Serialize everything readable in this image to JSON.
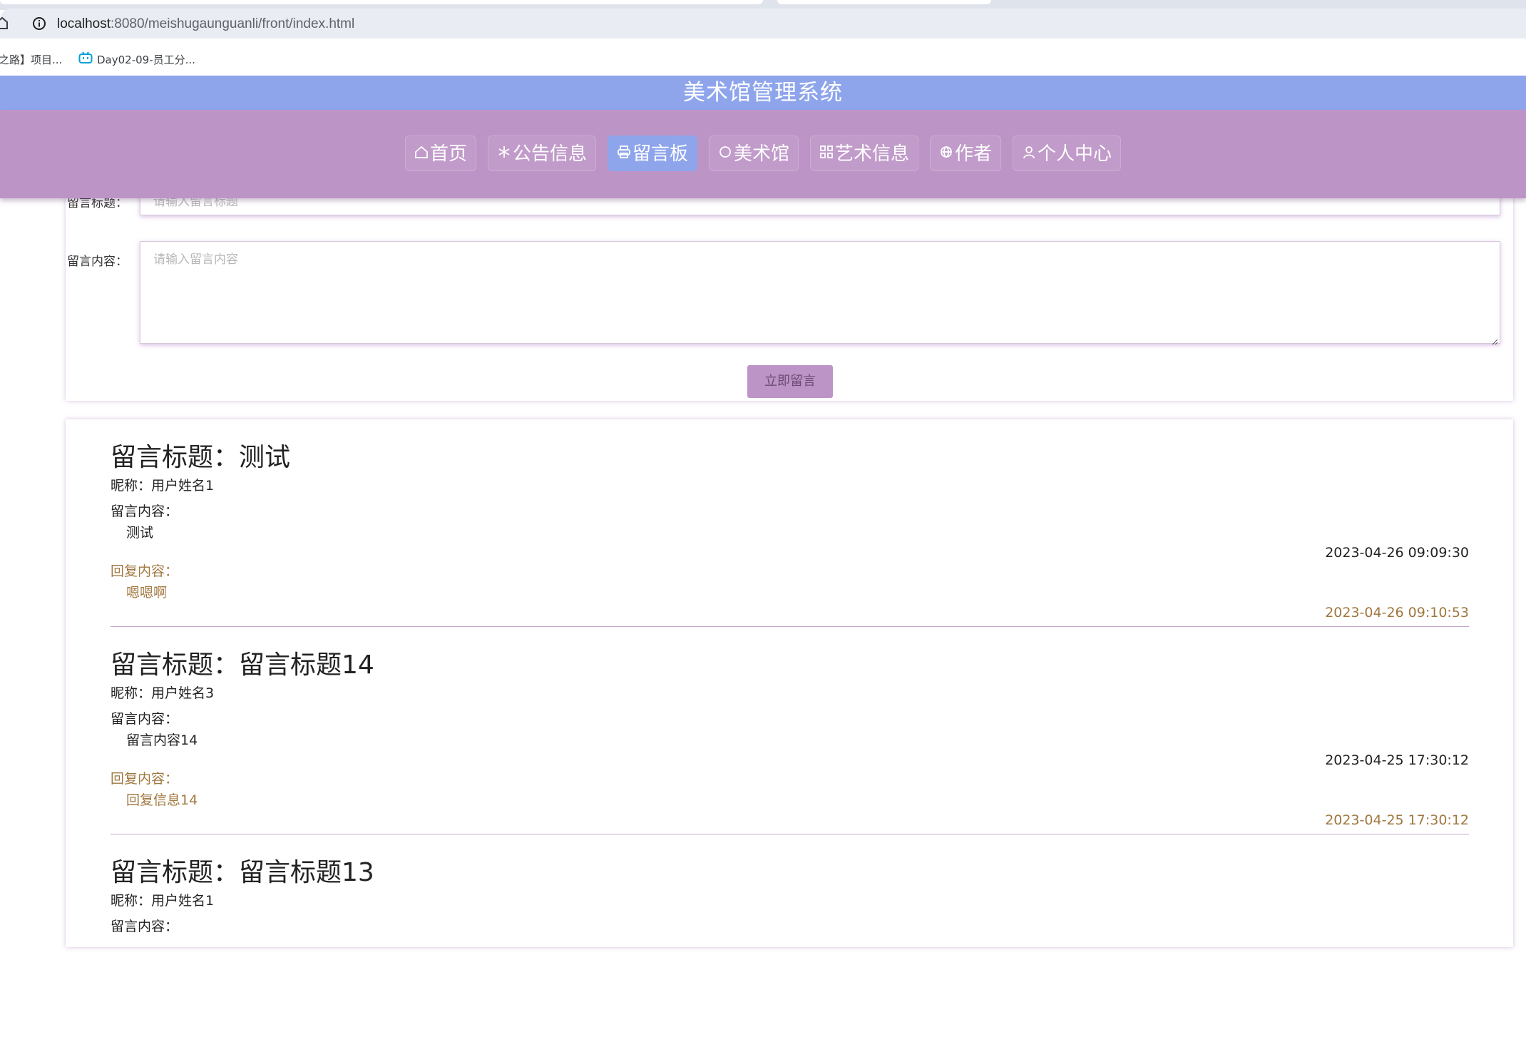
{
  "browser": {
    "url_host": "localhost",
    "url_path": ":8080/meishugaunguanli/front/index.html",
    "bookmarks": [
      {
        "label": "之路】项目..."
      },
      {
        "label": "Day02-09-员工分..."
      }
    ]
  },
  "site": {
    "title": "美术馆管理系统",
    "nav": [
      {
        "label": "首页",
        "icon": "home-icon"
      },
      {
        "label": "公告信息",
        "icon": "snowflake-icon"
      },
      {
        "label": "留言板",
        "icon": "printer-icon",
        "active": true
      },
      {
        "label": "美术馆",
        "icon": "circle-icon"
      },
      {
        "label": "艺术信息",
        "icon": "grid-icon"
      },
      {
        "label": "作者",
        "icon": "globe-icon"
      },
      {
        "label": "个人中心",
        "icon": "person-icon"
      }
    ],
    "accent_color": "#8ea5ec",
    "nav_color": "#bd94c6"
  },
  "form": {
    "title_label": "留言标题：",
    "title_placeholder": "请输入留言标题",
    "content_label": "留言内容：",
    "content_placeholder": "请输入留言内容",
    "submit_label": "立即留言"
  },
  "messages": [
    {
      "title": "留言标题：测试",
      "nickname": "昵称：用户姓名1",
      "content_label": "留言内容：",
      "content": "测试",
      "time": "2023-04-26 09:09:30",
      "reply_label": "回复内容：",
      "reply": "嗯嗯啊",
      "reply_time": "2023-04-26 09:10:53"
    },
    {
      "title": "留言标题：留言标题14",
      "nickname": "昵称：用户姓名3",
      "content_label": "留言内容：",
      "content": "留言内容14",
      "time": "2023-04-25 17:30:12",
      "reply_label": "回复内容：",
      "reply": "回复信息14",
      "reply_time": "2023-04-25 17:30:12"
    },
    {
      "title": "留言标题：留言标题13",
      "nickname": "昵称：用户姓名1",
      "content_label": "留言内容："
    }
  ]
}
